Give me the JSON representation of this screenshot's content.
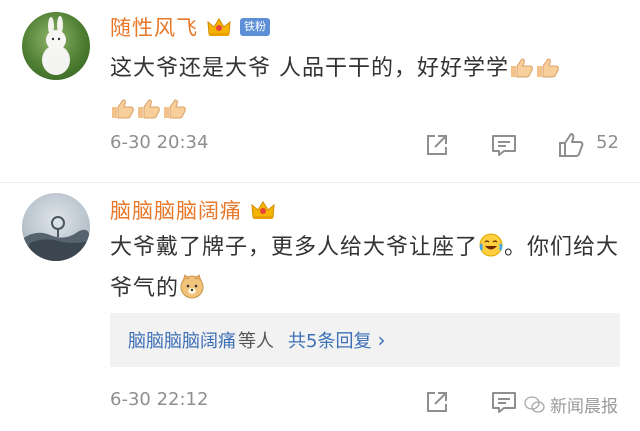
{
  "comments": [
    {
      "username": "随性风飞",
      "badge": "铁粉",
      "text_main": "这大爷还是大爷 人品干干的，好好学学",
      "emoji_end": "thumbs-up x5",
      "timestamp": "6-30 20:34",
      "likes": "52"
    },
    {
      "username": "脑脑脑脑阔痛",
      "text_line": "大爷戴了牌子，更多人给大爷让座了",
      "text_after_emoji": "。你们给大爷气的",
      "emoji_mid": "laugh-tears",
      "emoji_end": "doge",
      "timestamp": "6-30 22:12",
      "reply": {
        "names": "脑脑脑脑阔痛",
        "suffix": "等人",
        "total": "共5条回复"
      }
    }
  ],
  "watermark": "新闻晨报",
  "colors": {
    "username": "#e8782a",
    "link": "#3d6fb6",
    "meta": "#8f8f8f",
    "badge": "#5d8fd6"
  }
}
